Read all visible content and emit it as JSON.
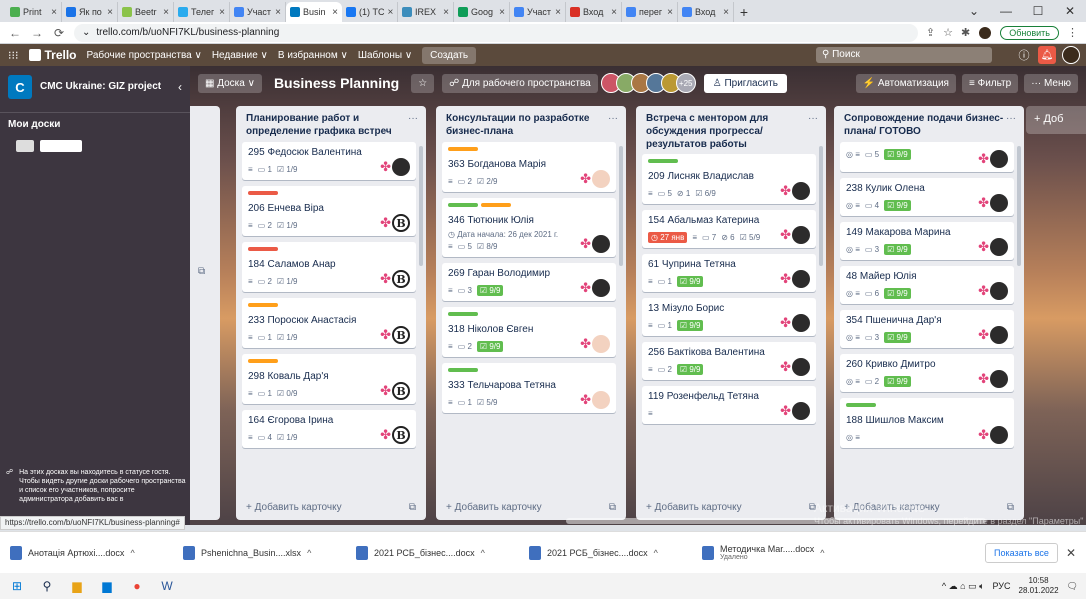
{
  "browser": {
    "tabs": [
      {
        "label": "Print",
        "color": "#4caf50"
      },
      {
        "label": "Як по",
        "color": "#1a73e8"
      },
      {
        "label": "Beetr",
        "color": "#8bc34a"
      },
      {
        "label": "Телег",
        "color": "#2aabee"
      },
      {
        "label": "Участ",
        "color": "#4285f4"
      },
      {
        "label": "Busin",
        "color": "#0079bf",
        "active": true
      },
      {
        "label": "(1) ТС",
        "color": "#1877f2"
      },
      {
        "label": "IREX",
        "color": "#3c8dbc"
      },
      {
        "label": "Goog",
        "color": "#0f9d58"
      },
      {
        "label": "Участ",
        "color": "#4285f4"
      },
      {
        "label": "Вход",
        "color": "#d93025"
      },
      {
        "label": "перег",
        "color": "#4285f4"
      },
      {
        "label": "Вход",
        "color": "#4285f4"
      }
    ],
    "url": "trello.com/b/uoNFI7KL/business-planning",
    "renew": "Обновить",
    "status_url": "https://trello.com/b/uoNFI7KL/business-planning#"
  },
  "trello": {
    "logo": "Trello",
    "menu": [
      "Рабочие пространства ∨",
      "Недавние ∨",
      "В избранном ∨",
      "Шаблоны ∨"
    ],
    "create": "Создать",
    "search": "Поиск"
  },
  "sidebar": {
    "workspace": "CMC Ukraine: GIZ project",
    "badge": "C",
    "my_boards": "Мои доски",
    "note": "На этих досках вы находитесь в статусе гостя. Чтобы видеть другие доски рабочего пространства и список его участников, попросите администратора добавить вас в"
  },
  "board": {
    "view": "Доска ∨",
    "title": "Business Planning",
    "visibility": "Для рабочего пространства",
    "members_more": "+25",
    "invite": "Пригласить",
    "automation": "Автоматизация",
    "filter": "Фильтр",
    "menu": "Меню",
    "add_list": "+ Доб",
    "add_card": "+ Добавить карточку",
    "watermark": "Активация Windows",
    "watermark_sub": "Чтобы активировать Windows, перейдите в раздел \"Параметры\""
  },
  "lanes": [
    {
      "title": "",
      "cards": []
    },
    {
      "title": "Планирование работ и определение графика встреч",
      "cards": [
        {
          "title": "295 Федосюк Валентина",
          "comments": "1",
          "checklist": "1/9",
          "member": "photo"
        },
        {
          "label": "#eb5a46",
          "title": "206 Енчева Віра",
          "comments": "2",
          "checklist": "1/9",
          "member": "b"
        },
        {
          "label": "#eb5a46",
          "title": "184 Саламов Анар",
          "comments": "2",
          "checklist": "1/9",
          "member": "b"
        },
        {
          "label": "#ff9f1a",
          "title": "233 Поросюк Анастасія",
          "comments": "1",
          "checklist": "1/9",
          "member": "b"
        },
        {
          "label": "#ff9f1a",
          "title": "298 Коваль Дар'я",
          "comments": "1",
          "checklist": "0/9",
          "member": "b"
        },
        {
          "title": "164 Єгорова Ірина",
          "comments": "4",
          "checklist": "1/9",
          "member": "b"
        }
      ]
    },
    {
      "title": "Консультации по разработке бизнес-плана",
      "cards": [
        {
          "label": "#ff9f1a",
          "title": "363 Богданова Марія",
          "comments": "2",
          "checklist": "2/9",
          "member": "f"
        },
        {
          "label": "#61bd4f",
          "label2": "#ff9f1a",
          "title": "346 Тютюник Юлія",
          "date": "Дата начала: 26 дек 2021 г.",
          "comments": "5",
          "checklist": "8/9",
          "member": "photo"
        },
        {
          "title": "269 Гаран Володимир",
          "comments": "3",
          "chk": "9/9",
          "member": "photo"
        },
        {
          "label": "#61bd4f",
          "title": "318 Ніколов Євген",
          "comments": "2",
          "chk": "9/9",
          "member": "f"
        },
        {
          "label": "#61bd4f",
          "title": "333 Тельчарова Тетяна",
          "comments": "1",
          "checklist": "5/9",
          "member": "f"
        }
      ]
    },
    {
      "title": "Встреча с ментором для обсуждения прогресса/ результатов работы",
      "cards": [
        {
          "label": "#61bd4f",
          "title": "209 Лисняк Владислав",
          "comments": "5",
          "att": "1",
          "checklist": "6/9",
          "member": "photo"
        },
        {
          "title": "154 Абальмаз Катерина",
          "due": "27 янв",
          "comments": "7",
          "att": "6",
          "checklist": "5/9",
          "member": "photo"
        },
        {
          "title": "61 Чуприна Тетяна",
          "comments": "1",
          "chk": "9/9",
          "member": "photo"
        },
        {
          "title": "13 Мізуло Борис",
          "comments": "1",
          "chk": "9/9",
          "member": "photo"
        },
        {
          "title": "256 Бактікова Валентина",
          "comments": "2",
          "chk": "9/9",
          "member": "photo"
        },
        {
          "title": "119 Розенфельд Тетяна",
          "comments": "",
          "member": "photo"
        }
      ]
    },
    {
      "title": "Сопровождение подачи бизнес-плана/ ГОТОВО",
      "cards": [
        {
          "title": "",
          "comments": "5",
          "chk": "9/9",
          "member": "photo"
        },
        {
          "title": "238 Кулик Олена",
          "comments": "4",
          "chk": "9/9",
          "member": "photo"
        },
        {
          "title": "149 Макарова Марина",
          "comments": "3",
          "chk": "9/9",
          "member": "photo"
        },
        {
          "title": "48 Майер Юлія",
          "comments": "6",
          "chk": "9/9",
          "member": "photo"
        },
        {
          "title": "354 Пшенична Дар'я",
          "comments": "3",
          "chk": "9/9",
          "member": "photo"
        },
        {
          "title": "260 Кривко Дмитро",
          "comments": "2",
          "chk": "9/9",
          "member": "photo"
        },
        {
          "label": "#61bd4f",
          "title": "188 Шишлов Максим",
          "comments": "",
          "member": "photo"
        }
      ]
    }
  ],
  "downloads": [
    {
      "name": "Анотація Артюхі....docx",
      "sub": ""
    },
    {
      "name": "Pshenichna_Busin....xlsx",
      "sub": ""
    },
    {
      "name": "2021 РСБ_бізнес....docx",
      "sub": ""
    },
    {
      "name": "2021 РСБ_бізнес....docx",
      "sub": ""
    },
    {
      "name": "Методичка Mar.....docx",
      "sub": "Удалено"
    }
  ],
  "show_all": "Показать все",
  "taskbar": {
    "lang": "РУС",
    "time": "10:58",
    "date": "28.01.2022"
  }
}
